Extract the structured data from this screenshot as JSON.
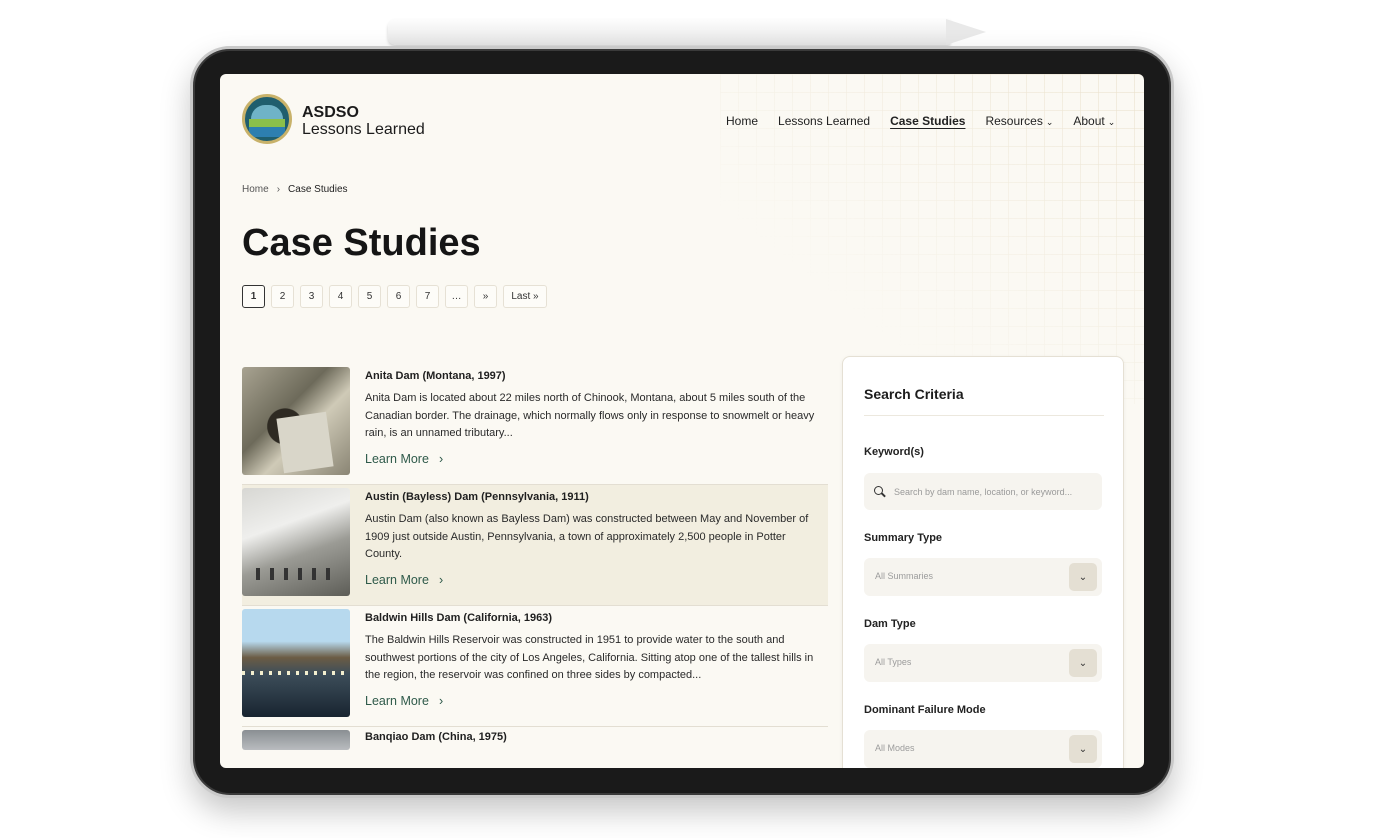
{
  "brand": {
    "title": "ASDSO",
    "subtitle": "Lessons Learned"
  },
  "nav": {
    "home": "Home",
    "lessons": "Lessons Learned",
    "case_studies": "Case Studies",
    "resources": "Resources",
    "about": "About",
    "caret": "⌄"
  },
  "breadcrumb": {
    "home": "Home",
    "sep": "›",
    "current": "Case Studies"
  },
  "page_title": "Case Studies",
  "pagination": {
    "pages": [
      "1",
      "2",
      "3",
      "4",
      "5",
      "6",
      "7"
    ],
    "ellipsis": "…",
    "next": "»",
    "last": "Last »",
    "current": "1"
  },
  "cases": [
    {
      "title": "Anita Dam (Montana, 1997)",
      "description": "Anita Dam is located about 22 miles north of Chinook, Montana, about 5 miles south of the Canadian border. The drainage, which normally flows only in response to snowmelt or heavy rain, is an unnamed tributary...",
      "link": "Learn More"
    },
    {
      "title": "Austin (Bayless) Dam (Pennsylvania, 1911)",
      "description": "Austin Dam (also known as Bayless Dam) was constructed between May and November of 1909 just outside Austin, Pennsylvania, a town of approximately 2,500 people in Potter County.",
      "link": "Learn More"
    },
    {
      "title": "Baldwin Hills Dam (California, 1963)",
      "description": "The Baldwin Hills Reservoir was constructed in 1951 to provide water to the south and southwest portions of the city of Los Angeles, California. Sitting atop one of the tallest hills in the region, the reservoir was confined on three sides by compacted...",
      "link": "Learn More"
    },
    {
      "title": "Banqiao Dam (China, 1975)"
    }
  ],
  "link_chevron": "›",
  "sidebar": {
    "title": "Search Criteria",
    "keyword_label": "Keyword(s)",
    "keyword_placeholder": "Search by dam name, location, or keyword...",
    "summary_label": "Summary Type",
    "summary_value": "All Summaries",
    "dam_type_label": "Dam Type",
    "dam_type_value": "All Types",
    "failure_label": "Dominant Failure Mode",
    "failure_value": "All Modes",
    "dropdown_glyph": "⌄"
  }
}
